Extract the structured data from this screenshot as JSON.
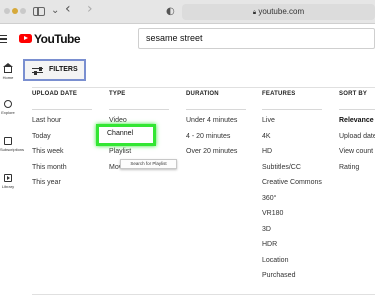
{
  "browser": {
    "url": "youtube.com",
    "lock_icon": "lock-icon",
    "back_icon": "‹",
    "forward_icon": "›",
    "shield_icon": "◐"
  },
  "header": {
    "logo_text": "YouTube",
    "search_value": "sesame street"
  },
  "nav": {
    "items": [
      {
        "label": "Home",
        "icon": "home-icon"
      },
      {
        "label": "Explore",
        "icon": "compass-icon"
      },
      {
        "label": "Subscriptions",
        "icon": "subscriptions-icon"
      },
      {
        "label": "Library",
        "icon": "library-icon"
      }
    ]
  },
  "filters": {
    "button_label": "FILTERS",
    "columns": [
      {
        "heading": "UPLOAD DATE",
        "options": [
          "Last hour",
          "Today",
          "This week",
          "This month",
          "This year"
        ]
      },
      {
        "heading": "TYPE",
        "options": [
          "Video",
          "Channel",
          "Playlist",
          "Movie"
        ]
      },
      {
        "heading": "DURATION",
        "options": [
          "Under 4 minutes",
          "4 - 20 minutes",
          "Over 20 minutes"
        ]
      },
      {
        "heading": "FEATURES",
        "options": [
          "Live",
          "4K",
          "HD",
          "Subtitles/CC",
          "Creative Commons",
          "360°",
          "VR180",
          "3D",
          "HDR",
          "Location",
          "Purchased"
        ]
      },
      {
        "heading": "SORT BY",
        "options": [
          "Relevance",
          "Upload date",
          "View count",
          "Rating"
        ]
      }
    ],
    "tooltip": "Search for Playlist",
    "highlight_color": "#33e633"
  }
}
